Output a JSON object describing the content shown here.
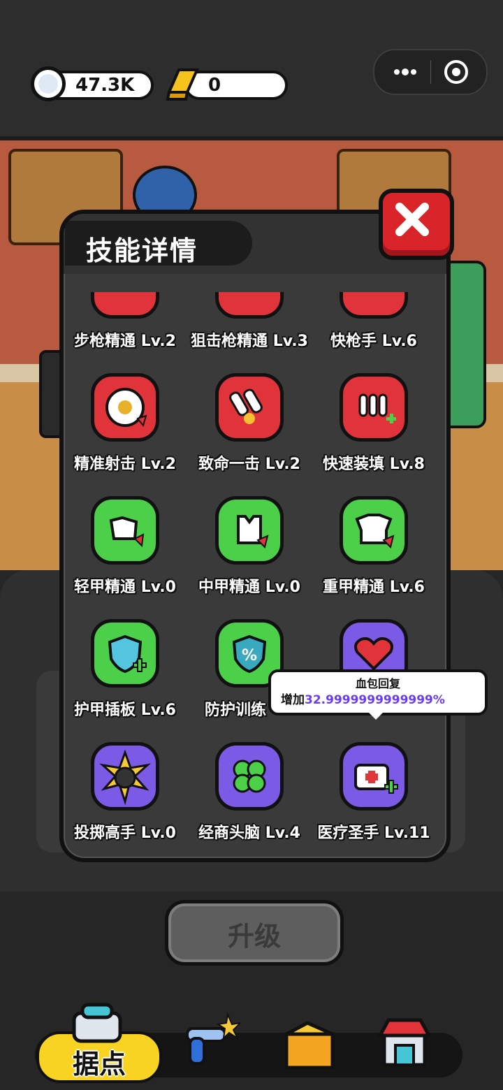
{
  "currency": {
    "silver": "47.3K",
    "gold": "0"
  },
  "modal": {
    "title": "技能详情",
    "skills": [
      {
        "label": "步枪精通 Lv.2",
        "color": "red"
      },
      {
        "label": "狙击枪精通 Lv.3",
        "color": "red"
      },
      {
        "label": "快枪手 Lv.6",
        "color": "red"
      },
      {
        "label": "精准射击 Lv.2",
        "color": "red"
      },
      {
        "label": "致命一击 Lv.2",
        "color": "red"
      },
      {
        "label": "快速装填 Lv.8",
        "color": "red"
      },
      {
        "label": "轻甲精通 Lv.0",
        "color": "green"
      },
      {
        "label": "中甲精通 Lv.0",
        "color": "green"
      },
      {
        "label": "重甲精通 Lv.6",
        "color": "green"
      },
      {
        "label": "护甲插板 Lv.6",
        "color": "green"
      },
      {
        "label": "防护训练",
        "color": "green"
      },
      {
        "label": "",
        "color": "purple"
      },
      {
        "label": "投掷高手 Lv.0",
        "color": "purple"
      },
      {
        "label": "经商头脑 Lv.4",
        "color": "purple"
      },
      {
        "label": "医疗圣手 Lv.11",
        "color": "purple"
      }
    ]
  },
  "tooltip": {
    "title": "血包回复",
    "prefix": "增加",
    "value": "32.9999999999999%"
  },
  "upgrade_label": "升级",
  "nav": {
    "home_label": "据点"
  },
  "colors": {
    "red_skill": "#e0333a",
    "green_skill": "#4cd04a",
    "purple_skill": "#7b5be6",
    "home_tab": "#f8d322",
    "close_button": "#d9252a"
  }
}
